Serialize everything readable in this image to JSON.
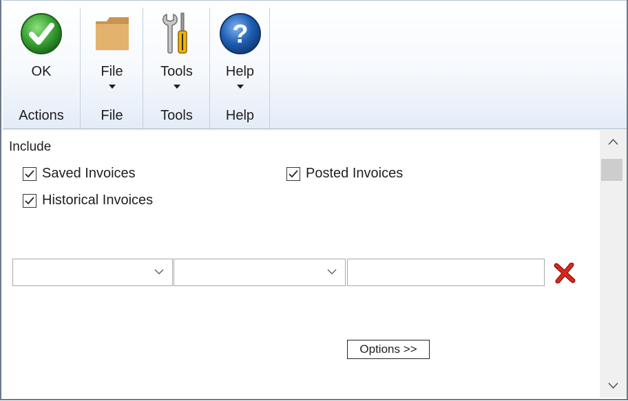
{
  "ribbon": {
    "actions": {
      "button_label": "OK",
      "group_label": "Actions",
      "icon": "ok-check-icon"
    },
    "file": {
      "button_label": "File",
      "group_label": "File",
      "icon": "folder-icon"
    },
    "tools": {
      "button_label": "Tools",
      "group_label": "Tools",
      "icon": "tools-icon"
    },
    "help": {
      "button_label": "Help",
      "group_label": "Help",
      "icon": "help-icon"
    }
  },
  "include": {
    "label": "Include",
    "saved_label": "Saved Invoices",
    "saved_checked": true,
    "posted_label": "Posted Invoices",
    "posted_checked": true,
    "historical_label": "Historical Invoices",
    "historical_checked": true
  },
  "filter": {
    "field_value": "",
    "operator_value": "",
    "text_value": ""
  },
  "options_button_label": "Options >>",
  "colors": {
    "ok_green": "#3aa335",
    "help_blue": "#1f5fb4",
    "folder_tan": "#e3b36e",
    "clear_red": "#c8221c"
  }
}
